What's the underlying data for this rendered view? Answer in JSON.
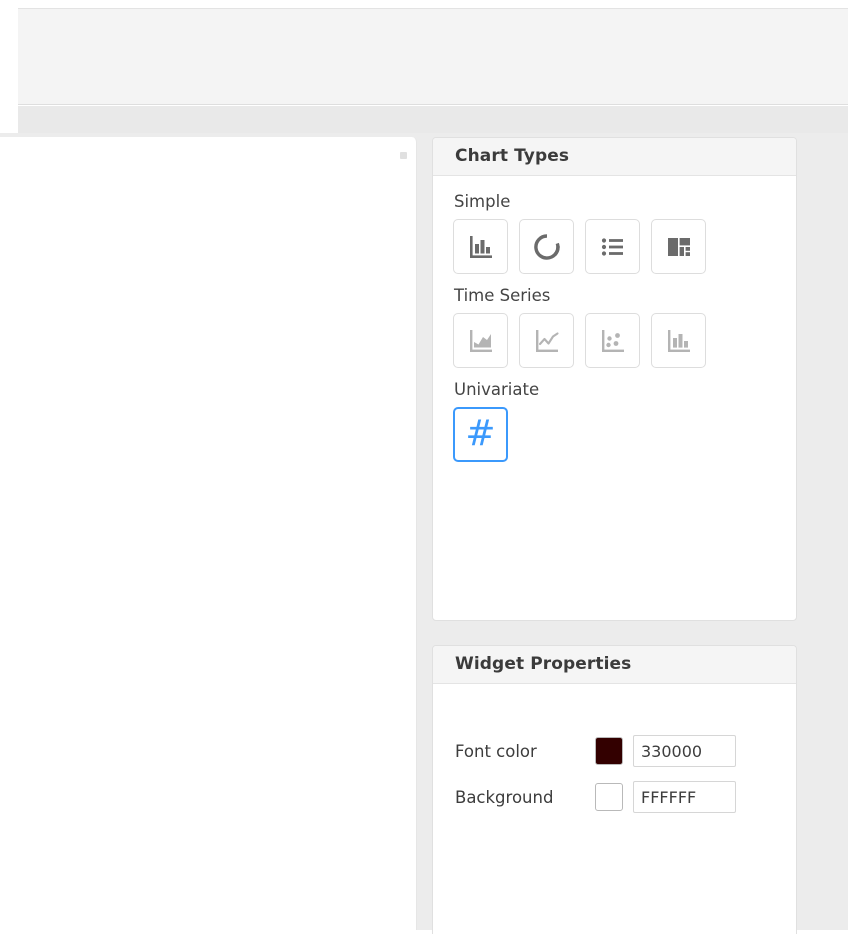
{
  "window": {
    "toolbar_area_label": "toolbar",
    "secondary_bar_label": "secondary-toolbar"
  },
  "canvas": {
    "marker_icon": "resize-handle-icon"
  },
  "chart_types_panel": {
    "title": "Chart Types",
    "groups": [
      {
        "label": "Simple",
        "items": [
          {
            "icon": "bar-chart-icon",
            "name": "chart-type-bar",
            "selected": false,
            "enabled": true
          },
          {
            "icon": "donut-chart-icon",
            "name": "chart-type-donut",
            "selected": false,
            "enabled": true
          },
          {
            "icon": "list-icon",
            "name": "chart-type-list",
            "selected": false,
            "enabled": true
          },
          {
            "icon": "layout-grid-icon",
            "name": "chart-type-layout",
            "selected": false,
            "enabled": true
          }
        ]
      },
      {
        "label": "Time Series",
        "items": [
          {
            "icon": "area-chart-icon",
            "name": "chart-type-area",
            "selected": false,
            "enabled": false
          },
          {
            "icon": "line-chart-icon",
            "name": "chart-type-line",
            "selected": false,
            "enabled": false
          },
          {
            "icon": "scatter-plot-icon",
            "name": "chart-type-scatter",
            "selected": false,
            "enabled": false
          },
          {
            "icon": "bar-chart-icon",
            "name": "chart-type-timeseries-bar",
            "selected": false,
            "enabled": false
          }
        ]
      },
      {
        "label": "Univariate",
        "items": [
          {
            "icon": "hash-icon",
            "name": "chart-type-number",
            "glyph": "#",
            "selected": true,
            "enabled": true
          }
        ]
      }
    ]
  },
  "widget_properties_panel": {
    "title": "Widget Properties",
    "rows": [
      {
        "label": "Font color",
        "swatch_name": "font-color-swatch",
        "input_name": "font-color-hex-input",
        "value": "330000",
        "color": "#330000"
      },
      {
        "label": "Background",
        "swatch_name": "background-color-swatch",
        "input_name": "background-color-hex-input",
        "value": "FFFFFF",
        "color": "#FFFFFF"
      }
    ]
  },
  "colors": {
    "accent_blue": "#3b99fc",
    "icon_enabled": "#6b6b6b",
    "icon_disabled": "#b4b4b4",
    "panel_header_bg": "#f5f5f5",
    "workspace_bg": "#ececec"
  }
}
